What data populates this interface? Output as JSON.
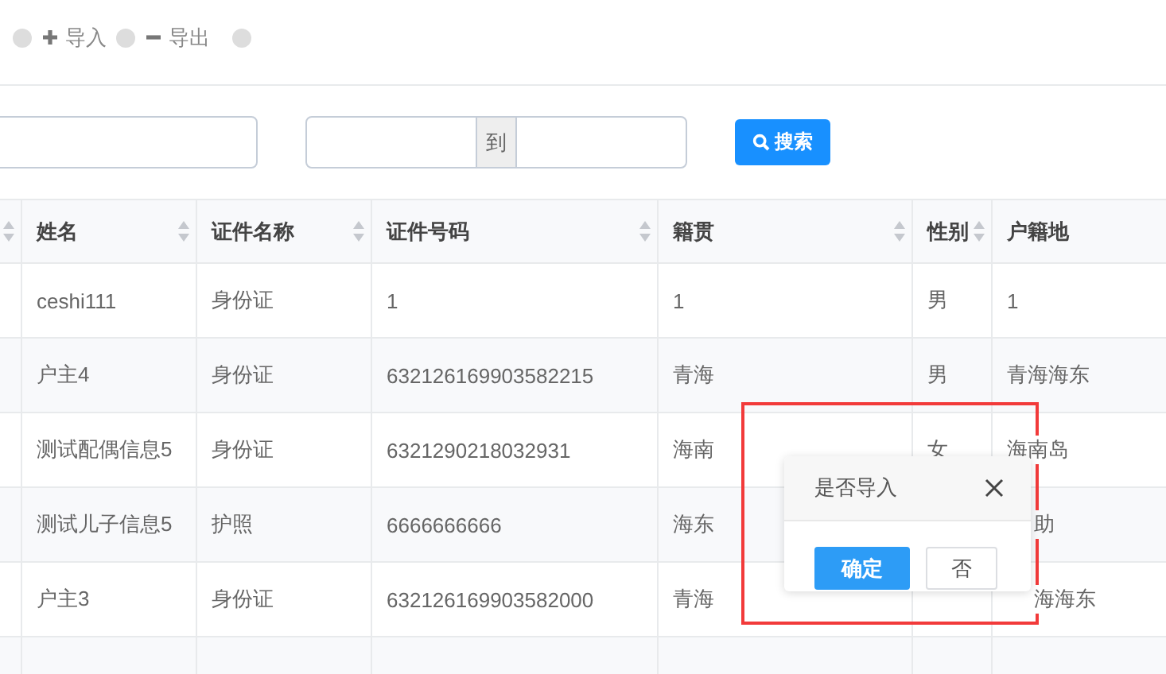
{
  "toolbar": {
    "actions": [
      {
        "kind": "add",
        "label": "导入"
      },
      {
        "kind": "remove",
        "label": "导出"
      }
    ]
  },
  "search": {
    "range_separator": "到",
    "button": "搜索"
  },
  "table": {
    "columns": [
      {
        "sortable": true
      },
      {
        "label": "姓名",
        "sortable": true
      },
      {
        "label": "证件名称",
        "sortable": true
      },
      {
        "label": "证件号码",
        "sortable": true
      },
      {
        "label": "籍贯",
        "sortable": true
      },
      {
        "label": "性别",
        "sortable": true
      },
      {
        "label": "户籍地",
        "sortable": false
      }
    ],
    "rows": [
      {
        "cells": [
          "",
          "ceshi111",
          "身份证",
          "1",
          "1",
          "男",
          "1"
        ]
      },
      {
        "cells": [
          "",
          "户主4",
          "身份证",
          "632126169903582215",
          "青海",
          "男",
          "青海海东"
        ]
      },
      {
        "cells": [
          "",
          "测试配偶信息5",
          "身份证",
          "6321290218032931",
          "海南",
          "女",
          "海南岛"
        ]
      },
      {
        "cells": [
          "",
          "测试儿子信息5",
          "护照",
          "6666666666",
          "海东",
          null,
          "助"
        ]
      },
      {
        "cells": [
          "",
          "户主3",
          "身份证",
          "632126169903582000",
          "青海",
          null,
          "海海东"
        ]
      }
    ]
  },
  "popover": {
    "title": "是否导入",
    "buttons": [
      {
        "label": "确定",
        "primary": true
      },
      {
        "label": "否",
        "primary": false
      }
    ]
  },
  "highlight_frame": true
}
